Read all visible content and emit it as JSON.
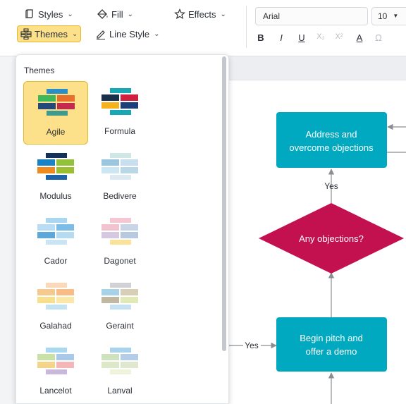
{
  "toolbar": {
    "styles_label": "Styles",
    "fill_label": "Fill",
    "effects_label": "Effects",
    "themes_label": "Themes",
    "line_style_label": "Line Style",
    "font_family": "Arial",
    "font_size": "10",
    "bold": "B",
    "italic": "I",
    "underline": "U",
    "subscript": "X₂",
    "superscript": "X²",
    "font_color": "A",
    "special_char": "Ω"
  },
  "themes_panel": {
    "title": "Themes",
    "themes": [
      {
        "name": "Agile",
        "selected": true,
        "colors": [
          "#2a8fc9",
          "#3fb85a",
          "#e8702c",
          "#24487a",
          "#c4294e",
          "#3f9a8e"
        ]
      },
      {
        "name": "Formula",
        "selected": false,
        "colors": [
          "#19a6b5",
          "#1a2f4a",
          "#d0203f",
          "#f5b21c",
          "#1c3f7a",
          "#19a6b5"
        ]
      },
      {
        "name": "Modulus",
        "selected": false,
        "colors": [
          "#14325c",
          "#1a83c6",
          "#93c23a",
          "#f08a1c",
          "#9cbf2f",
          "#1e63a8"
        ]
      },
      {
        "name": "Bedivere",
        "selected": false,
        "colors": [
          "#cfe7e6",
          "#9ac6e0",
          "#c7dfee",
          "#cde6f4",
          "#b9d7e6",
          "#dde9f2"
        ]
      },
      {
        "name": "Cador",
        "selected": false,
        "colors": [
          "#a9d7f2",
          "#b8ddf5",
          "#7bbde6",
          "#5da8d9",
          "#b6daf0",
          "#c8e4f5"
        ]
      },
      {
        "name": "Dagonet",
        "selected": false,
        "colors": [
          "#f4c7d2",
          "#f2c3cf",
          "#c8d5e6",
          "#d6c8e0",
          "#b7c9df",
          "#fbe29a"
        ]
      },
      {
        "name": "Galahad",
        "selected": false,
        "colors": [
          "#fbd9b8",
          "#f6c98f",
          "#f8bd86",
          "#f8df8e",
          "#fbe7a8",
          "#c5e2f3"
        ]
      },
      {
        "name": "Geraint",
        "selected": false,
        "colors": [
          "#cfd1d4",
          "#a8d2e8",
          "#d8cfb8",
          "#c1b8a2",
          "#e2e9b9",
          "#c6e1f2"
        ]
      },
      {
        "name": "Lancelot",
        "selected": false,
        "colors": [
          "#a8d8f2",
          "#c9e0a6",
          "#a9c8ea",
          "#f4d38a",
          "#f4b6b6",
          "#c9b8dc"
        ]
      },
      {
        "name": "Lanval",
        "selected": false,
        "colors": [
          "#a9d2ef",
          "#cfe2c0",
          "#b5cde6",
          "#dde8c8",
          "#dfe7cf",
          "#eef3d9"
        ]
      }
    ]
  },
  "diagram": {
    "box1_line1": "Address and",
    "box1_line2": "overcome objections",
    "yes_top": "Yes",
    "decision_text": "Any objections?",
    "yes_left": "Yes",
    "box2_line1": "Begin pitch and",
    "box2_line2": "offer a demo",
    "box_color": "#00a9bf",
    "decision_color": "#c3104f",
    "line_color": "#8a8e94"
  }
}
